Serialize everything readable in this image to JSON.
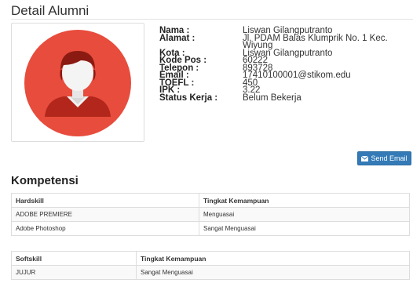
{
  "page": {
    "title": "Detail Alumni"
  },
  "profile": {
    "fields": [
      {
        "label": "Nama :",
        "value": "Liswan Gilangputranto"
      },
      {
        "label": "Alamat :",
        "value": "Jl. PDAM Balas Klumprik No. 1 Kec. Wiyung"
      },
      {
        "label": "Kota :",
        "value": "Liswan Gilangputranto"
      },
      {
        "label": "Kode Pos :",
        "value": "60222"
      },
      {
        "label": "Telepon :",
        "value": "893728"
      },
      {
        "label": "Email :",
        "value": "17410100001@stikom.edu"
      },
      {
        "label": "TOEFL :",
        "value": "450"
      },
      {
        "label": "IPK :",
        "value": "3.22"
      },
      {
        "label": "Status Kerja :",
        "value": "Belum Bekerja"
      }
    ]
  },
  "actions": {
    "send_email_label": "Send Email",
    "send_email_icon": "envelope-icon"
  },
  "competence": {
    "title": "Kompetensi",
    "hardskill": {
      "headers": [
        "Hardskill",
        "Tingkat Kemampuan"
      ],
      "rows": [
        [
          "ADOBE PREMIERE",
          "Menguasai"
        ],
        [
          "Adobe Photoshop",
          "Sangat Menguasai"
        ]
      ]
    },
    "softskill": {
      "headers": [
        "Softskill",
        "Tingkat Kemampuan"
      ],
      "rows": [
        [
          "JUJUR",
          "Sangat Menguasai"
        ]
      ]
    }
  },
  "colors": {
    "avatar_bg": "#e74c3c",
    "button": "#337ab7"
  }
}
